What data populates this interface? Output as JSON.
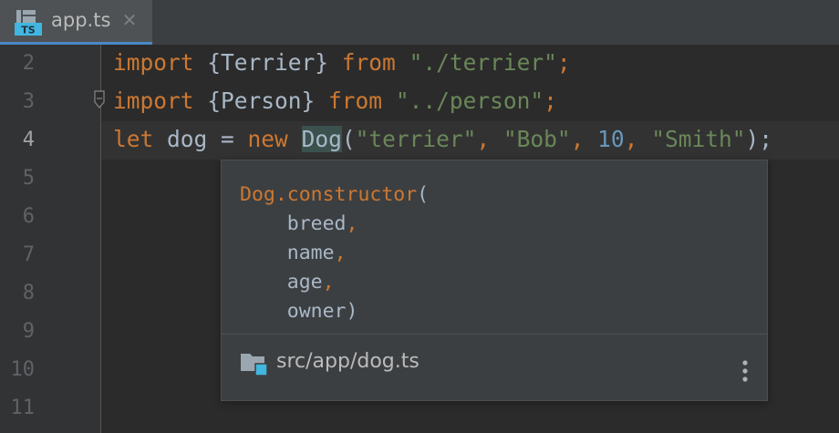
{
  "tab": {
    "file_name": "app.ts",
    "icon": "typescript-file-icon",
    "icon_text": "TS",
    "close_glyph": "✕"
  },
  "gutter": {
    "line_numbers": [
      "2",
      "3",
      "4",
      "5",
      "6",
      "7",
      "8",
      "9",
      "10",
      "11"
    ],
    "current_line": "4"
  },
  "code": {
    "line2": {
      "kw1": "import",
      "braces": " {Terrier} ",
      "kw2": "from",
      "space": " ",
      "str": "\"./terrier\"",
      "end": ";"
    },
    "line3": {
      "kw1": "import",
      "braces": " {Person} ",
      "kw2": "from",
      "space": " ",
      "str": "\"../person\"",
      "end": ";"
    },
    "line4": {
      "kw_let": "let",
      "var_part": " dog = ",
      "kw_new": "new",
      "space": " ",
      "class": "Dog",
      "open": "(",
      "arg1": "\"terrier\"",
      "comma1": ", ",
      "arg2": "\"Bob\"",
      "comma2": ", ",
      "arg3": "10",
      "comma3": ", ",
      "arg4": "\"Smith\"",
      "close": ");"
    }
  },
  "popup": {
    "signature_head": "Dog.constructor",
    "signature_open": "(",
    "params": [
      {
        "name": "breed",
        "sep": ","
      },
      {
        "name": "name",
        "sep": ","
      },
      {
        "name": "age",
        "sep": ","
      },
      {
        "name": "owner",
        "sep": ")"
      }
    ],
    "indent": "    ",
    "source_path": "src/app/dog.ts",
    "source_icon": "folder-icon",
    "menu_icon": "more-vertical-icon"
  },
  "colors": {
    "keyword": "#cc7832",
    "string": "#6a8759",
    "number": "#6897bb",
    "text": "#a9b7c6",
    "background": "#2b2b2b",
    "gutter": "#313335",
    "tab_underline": "#4a88c7",
    "popup_bg": "#3c3f41",
    "identifier_highlight": "#3b514d"
  }
}
